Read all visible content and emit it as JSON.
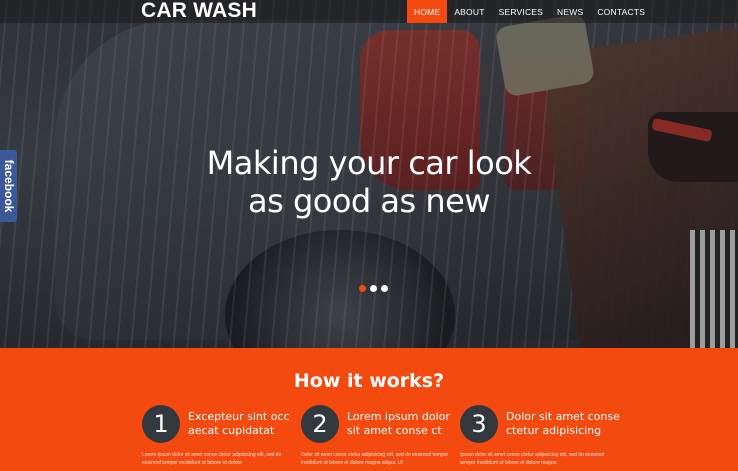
{
  "brand": {
    "logo": "CAR WASH"
  },
  "nav": [
    {
      "label": "HOME",
      "active": true
    },
    {
      "label": "ABOUT",
      "active": false
    },
    {
      "label": "SERVICES",
      "active": false
    },
    {
      "label": "NEWS",
      "active": false
    },
    {
      "label": "CONTACTS",
      "active": false
    }
  ],
  "hero": {
    "title_line1": "Making your car look",
    "title_line2": "as good as new",
    "slides": 3,
    "active_slide": 1
  },
  "social": {
    "facebook_tab": "facebook"
  },
  "how": {
    "title": "How it works?",
    "steps": [
      {
        "number": "1",
        "heading": "Excepteur sint occ aecat cupidatat",
        "text": "Lorem ipsum dolor sit amet conse ctetur adipisicing elit, sed do eiusmod tempor incididunt ut labore et dolore"
      },
      {
        "number": "2",
        "heading": "Lorem ipsum dolor sit amet conse ct",
        "text": "Dolor sit amet conse ctetur adipisicing elit, sed do eiusmod tempor incididunt ut labore et dolore magna aliqua. Ut"
      },
      {
        "number": "3",
        "heading": "Dolor sit amet conse ctetur adipisicing",
        "text": "Ipsum dolor sit amet conse ctetur adipisicing elit, sed do eiusmod tempor incididunt ut labore et dolore magna"
      }
    ]
  },
  "colors": {
    "accent": "#f4490f",
    "facebook": "#3b5998",
    "step_circle": "#33383f"
  }
}
